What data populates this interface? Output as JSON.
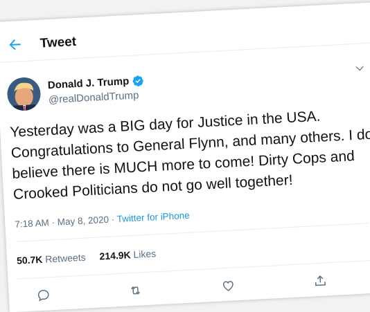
{
  "header": {
    "title": "Tweet"
  },
  "author": {
    "name": "Donald J. Trump",
    "handle": "@realDonaldTrump"
  },
  "tweet": {
    "text": "Yesterday was a BIG day for Justice in the USA. Congratulations to General Flynn, and many others. I do believe there is MUCH more to come! Dirty Cops and Crooked Politicians do not go well together!",
    "time": "7:18 AM",
    "date": "May 8, 2020",
    "separator": "·",
    "source": "Twitter for iPhone"
  },
  "stats": {
    "retweets_count": "50.7K",
    "retweets_label": "Retweets",
    "likes_count": "214.9K",
    "likes_label": "Likes"
  },
  "icons": {
    "back": "back-arrow-icon",
    "verified": "verified-badge-icon",
    "more": "chevron-down-icon",
    "reply": "reply-icon",
    "retweet": "retweet-icon",
    "like": "heart-icon",
    "share": "share-icon"
  },
  "colors": {
    "accent": "#1da1f2",
    "text": "#0f1419",
    "muted": "#5b7083",
    "border": "#e6ecf0"
  }
}
